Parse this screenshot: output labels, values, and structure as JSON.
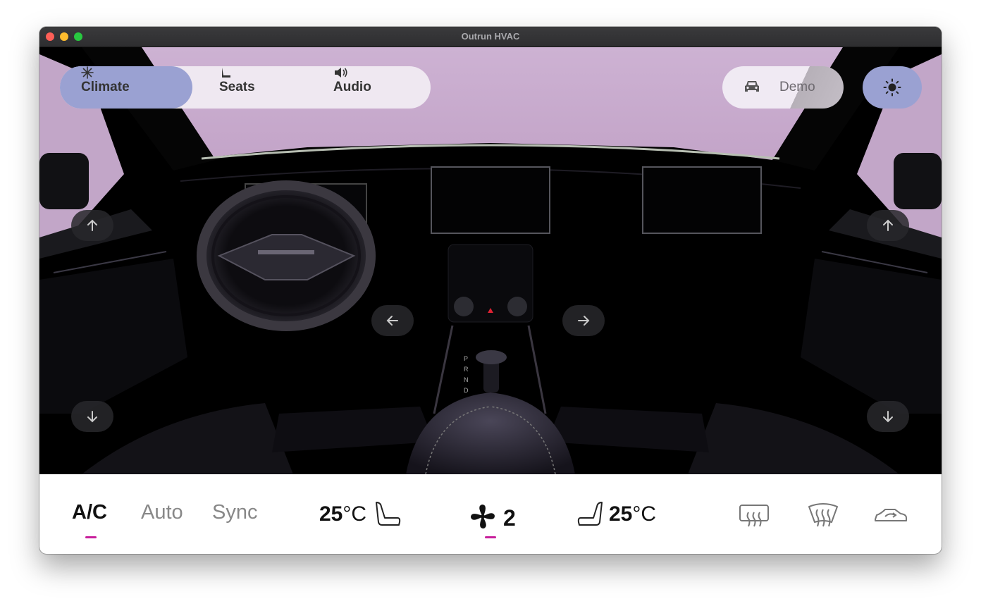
{
  "window": {
    "title": "Outrun HVAC"
  },
  "nav": {
    "tabs": [
      {
        "label": "Climate",
        "icon": "snowflake-icon",
        "active": true
      },
      {
        "label": "Seats",
        "icon": "seat-icon",
        "active": false
      },
      {
        "label": "Audio",
        "icon": "speaker-icon",
        "active": false
      }
    ],
    "demo_label": "Demo",
    "theme_icon": "sun-icon"
  },
  "colors": {
    "accent": "#9aa1d2",
    "indicator": "#c81f9b",
    "sky": "#c6a9cd"
  },
  "climate": {
    "modes": [
      {
        "label": "A/C",
        "active": true
      },
      {
        "label": "Auto",
        "active": false
      },
      {
        "label": "Sync",
        "active": false
      }
    ],
    "driver_temp": "25",
    "passenger_temp": "25",
    "temp_unit": "°C",
    "fan_speed": "2",
    "fan_on": true,
    "rear_defrost_icon": "rear-defrost-icon",
    "front_defrost_icon": "front-defrost-icon",
    "recirculation_icon": "recirculation-icon"
  }
}
